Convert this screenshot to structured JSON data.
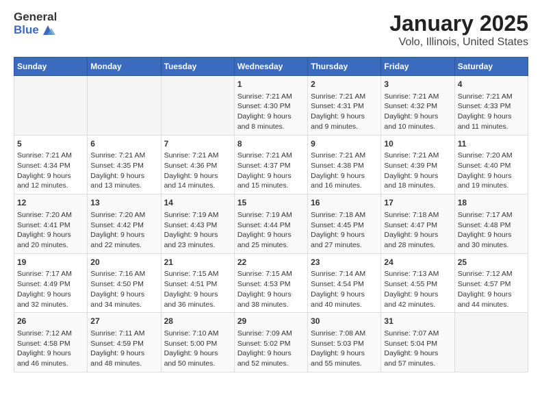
{
  "header": {
    "logo_general": "General",
    "logo_blue": "Blue",
    "title": "January 2025",
    "subtitle": "Volo, Illinois, United States"
  },
  "days_of_week": [
    "Sunday",
    "Monday",
    "Tuesday",
    "Wednesday",
    "Thursday",
    "Friday",
    "Saturday"
  ],
  "weeks": [
    [
      {
        "day": "",
        "info": ""
      },
      {
        "day": "",
        "info": ""
      },
      {
        "day": "",
        "info": ""
      },
      {
        "day": "1",
        "info": "Sunrise: 7:21 AM\nSunset: 4:30 PM\nDaylight: 9 hours and 8 minutes."
      },
      {
        "day": "2",
        "info": "Sunrise: 7:21 AM\nSunset: 4:31 PM\nDaylight: 9 hours and 9 minutes."
      },
      {
        "day": "3",
        "info": "Sunrise: 7:21 AM\nSunset: 4:32 PM\nDaylight: 9 hours and 10 minutes."
      },
      {
        "day": "4",
        "info": "Sunrise: 7:21 AM\nSunset: 4:33 PM\nDaylight: 9 hours and 11 minutes."
      }
    ],
    [
      {
        "day": "5",
        "info": "Sunrise: 7:21 AM\nSunset: 4:34 PM\nDaylight: 9 hours and 12 minutes."
      },
      {
        "day": "6",
        "info": "Sunrise: 7:21 AM\nSunset: 4:35 PM\nDaylight: 9 hours and 13 minutes."
      },
      {
        "day": "7",
        "info": "Sunrise: 7:21 AM\nSunset: 4:36 PM\nDaylight: 9 hours and 14 minutes."
      },
      {
        "day": "8",
        "info": "Sunrise: 7:21 AM\nSunset: 4:37 PM\nDaylight: 9 hours and 15 minutes."
      },
      {
        "day": "9",
        "info": "Sunrise: 7:21 AM\nSunset: 4:38 PM\nDaylight: 9 hours and 16 minutes."
      },
      {
        "day": "10",
        "info": "Sunrise: 7:21 AM\nSunset: 4:39 PM\nDaylight: 9 hours and 18 minutes."
      },
      {
        "day": "11",
        "info": "Sunrise: 7:20 AM\nSunset: 4:40 PM\nDaylight: 9 hours and 19 minutes."
      }
    ],
    [
      {
        "day": "12",
        "info": "Sunrise: 7:20 AM\nSunset: 4:41 PM\nDaylight: 9 hours and 20 minutes."
      },
      {
        "day": "13",
        "info": "Sunrise: 7:20 AM\nSunset: 4:42 PM\nDaylight: 9 hours and 22 minutes."
      },
      {
        "day": "14",
        "info": "Sunrise: 7:19 AM\nSunset: 4:43 PM\nDaylight: 9 hours and 23 minutes."
      },
      {
        "day": "15",
        "info": "Sunrise: 7:19 AM\nSunset: 4:44 PM\nDaylight: 9 hours and 25 minutes."
      },
      {
        "day": "16",
        "info": "Sunrise: 7:18 AM\nSunset: 4:45 PM\nDaylight: 9 hours and 27 minutes."
      },
      {
        "day": "17",
        "info": "Sunrise: 7:18 AM\nSunset: 4:47 PM\nDaylight: 9 hours and 28 minutes."
      },
      {
        "day": "18",
        "info": "Sunrise: 7:17 AM\nSunset: 4:48 PM\nDaylight: 9 hours and 30 minutes."
      }
    ],
    [
      {
        "day": "19",
        "info": "Sunrise: 7:17 AM\nSunset: 4:49 PM\nDaylight: 9 hours and 32 minutes."
      },
      {
        "day": "20",
        "info": "Sunrise: 7:16 AM\nSunset: 4:50 PM\nDaylight: 9 hours and 34 minutes."
      },
      {
        "day": "21",
        "info": "Sunrise: 7:15 AM\nSunset: 4:51 PM\nDaylight: 9 hours and 36 minutes."
      },
      {
        "day": "22",
        "info": "Sunrise: 7:15 AM\nSunset: 4:53 PM\nDaylight: 9 hours and 38 minutes."
      },
      {
        "day": "23",
        "info": "Sunrise: 7:14 AM\nSunset: 4:54 PM\nDaylight: 9 hours and 40 minutes."
      },
      {
        "day": "24",
        "info": "Sunrise: 7:13 AM\nSunset: 4:55 PM\nDaylight: 9 hours and 42 minutes."
      },
      {
        "day": "25",
        "info": "Sunrise: 7:12 AM\nSunset: 4:57 PM\nDaylight: 9 hours and 44 minutes."
      }
    ],
    [
      {
        "day": "26",
        "info": "Sunrise: 7:12 AM\nSunset: 4:58 PM\nDaylight: 9 hours and 46 minutes."
      },
      {
        "day": "27",
        "info": "Sunrise: 7:11 AM\nSunset: 4:59 PM\nDaylight: 9 hours and 48 minutes."
      },
      {
        "day": "28",
        "info": "Sunrise: 7:10 AM\nSunset: 5:00 PM\nDaylight: 9 hours and 50 minutes."
      },
      {
        "day": "29",
        "info": "Sunrise: 7:09 AM\nSunset: 5:02 PM\nDaylight: 9 hours and 52 minutes."
      },
      {
        "day": "30",
        "info": "Sunrise: 7:08 AM\nSunset: 5:03 PM\nDaylight: 9 hours and 55 minutes."
      },
      {
        "day": "31",
        "info": "Sunrise: 7:07 AM\nSunset: 5:04 PM\nDaylight: 9 hours and 57 minutes."
      },
      {
        "day": "",
        "info": ""
      }
    ]
  ]
}
